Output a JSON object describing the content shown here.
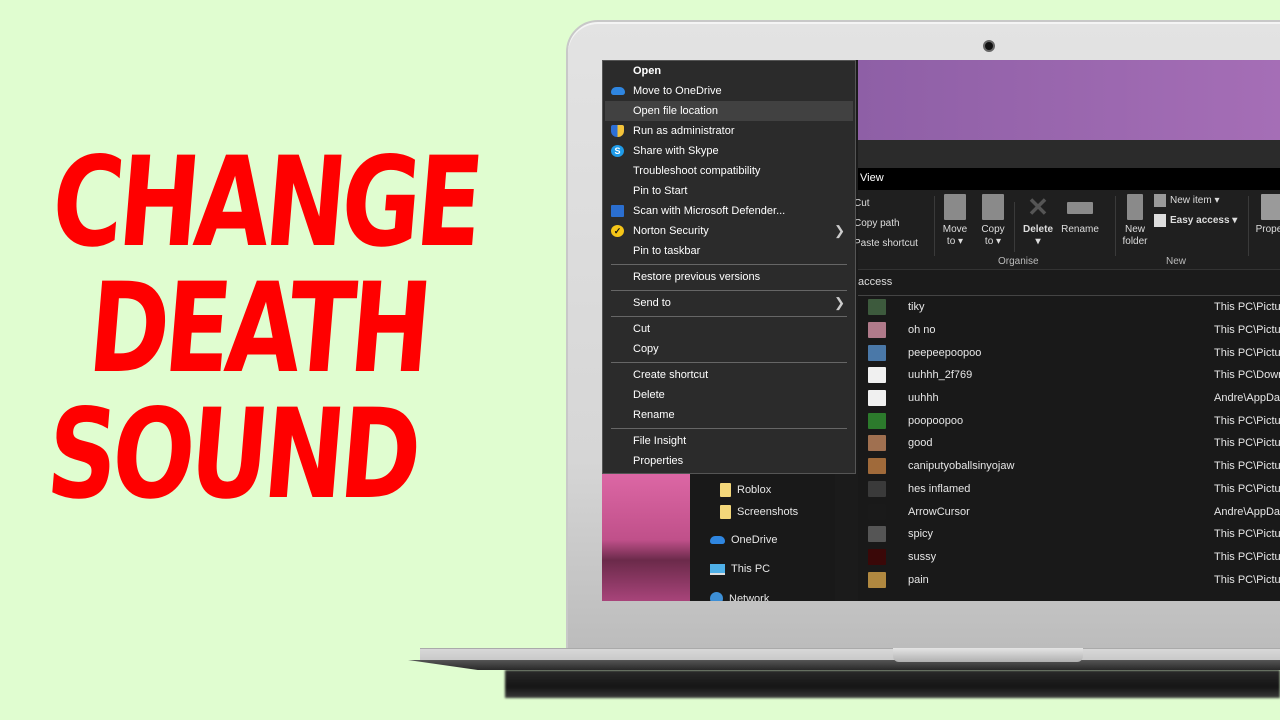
{
  "thumbnail": {
    "title_lines": [
      "CHANGE",
      "DEATH",
      "SOUND"
    ],
    "title_color": "#ff0000",
    "background_color": "#e0fdd0"
  },
  "context_menu": {
    "groups": [
      [
        {
          "label": "Open",
          "bold": true,
          "icon": null
        },
        {
          "label": "Move to OneDrive",
          "icon": "onedrive-icon"
        },
        {
          "label": "Open file location",
          "icon": null,
          "highlighted": true
        },
        {
          "label": "Run as administrator",
          "icon": "uac-shield-icon"
        },
        {
          "label": "Share with Skype",
          "icon": "skype-icon"
        },
        {
          "label": "Troubleshoot compatibility",
          "icon": null
        },
        {
          "label": "Pin to Start",
          "icon": null
        },
        {
          "label": "Scan with Microsoft Defender...",
          "icon": "defender-icon"
        },
        {
          "label": "Norton Security",
          "icon": "norton-icon",
          "submenu": true
        },
        {
          "label": "Pin to taskbar",
          "icon": null
        }
      ],
      [
        {
          "label": "Restore previous versions",
          "icon": null
        }
      ],
      [
        {
          "label": "Send to",
          "icon": null,
          "submenu": true
        }
      ],
      [
        {
          "label": "Cut",
          "icon": null
        },
        {
          "label": "Copy",
          "icon": null
        }
      ],
      [
        {
          "label": "Create shortcut",
          "icon": null
        },
        {
          "label": "Delete",
          "icon": null
        },
        {
          "label": "Rename",
          "icon": null
        }
      ],
      [
        {
          "label": "File Insight",
          "icon": null
        },
        {
          "label": "Properties",
          "icon": null
        }
      ]
    ]
  },
  "explorer": {
    "tab": "View",
    "ribbon": {
      "clipboard": [
        "Cut",
        "Copy path",
        "Paste shortcut"
      ],
      "organise": {
        "label": "Organise",
        "buttons": [
          {
            "line1": "Move",
            "line2": "to ▾"
          },
          {
            "line1": "Copy",
            "line2": "to ▾"
          },
          {
            "line1": "Delete",
            "line2": "▾"
          },
          {
            "line1": "Rename",
            "line2": ""
          }
        ]
      },
      "new": {
        "label": "New",
        "new_folder": {
          "line1": "New",
          "line2": "folder"
        },
        "new_item": "New item ▾",
        "easy_access": "Easy access ▾"
      },
      "open": {
        "properties": "Propert"
      }
    },
    "address": "access",
    "files": [
      {
        "name": "tiky",
        "location": "This PC\\Pictu",
        "thumb_color": "#3d5a3d"
      },
      {
        "name": "oh no",
        "location": "This PC\\Pictu",
        "thumb_color": "#b07a8a"
      },
      {
        "name": "peepeepoopoo",
        "location": "This PC\\Pictu",
        "thumb_color": "#4a78a8"
      },
      {
        "name": "uuhhh_2f769",
        "location": "This PC\\Down",
        "thumb_color": "#f0f0f0"
      },
      {
        "name": "uuhhh",
        "location": "Andre\\AppDa",
        "thumb_color": "#f0f0f0"
      },
      {
        "name": "poopoopoo",
        "location": "This PC\\Pictu",
        "thumb_color": "#2c7a2c"
      },
      {
        "name": "good",
        "location": "This PC\\Pictu",
        "thumb_color": "#a07050"
      },
      {
        "name": "caniputyoballsinyojaw",
        "location": "This PC\\Pictu",
        "thumb_color": "#a06a3a"
      },
      {
        "name": "hes inflamed",
        "location": "This PC\\Pictu",
        "thumb_color": "#3a3a3a"
      },
      {
        "name": "ArrowCursor",
        "location": "Andre\\AppDa",
        "thumb_color": "#1a1a1a"
      },
      {
        "name": "spicy",
        "location": "This PC\\Pictu",
        "thumb_color": "#555555"
      },
      {
        "name": "sussy",
        "location": "This PC\\Pictu",
        "thumb_color": "#3a0808"
      },
      {
        "name": "pain",
        "location": "This PC\\Pictu",
        "thumb_color": "#b08840"
      }
    ],
    "nav": [
      {
        "label": "Roblox",
        "icon": "folder-icon"
      },
      {
        "label": "Screenshots",
        "icon": "folder-icon"
      },
      {
        "label": "OneDrive",
        "icon": "onedrive-icon"
      },
      {
        "label": "This PC",
        "icon": "this-pc-icon"
      },
      {
        "label": "Network",
        "icon": "network-icon"
      }
    ]
  }
}
